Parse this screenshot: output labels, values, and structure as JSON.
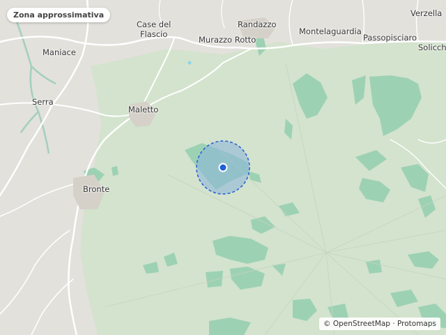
{
  "map": {
    "area_label": "Zona approssimativa",
    "attribution": "© OpenStreetMap · Protomaps",
    "places": {
      "casedelflascio": "Case del\nFlascio",
      "randazzo": "Randazzo",
      "murazzorotto": "Murazzo Rotto",
      "montelaguardia": "Montelaguardia",
      "passopisciaro": "Passopisciaro",
      "verzella": "Verzella",
      "solicchiata": "Solicchi",
      "maniace": "Maniace",
      "serra": "Serra",
      "maletto": "Maletto",
      "bronte": "Bronte"
    },
    "colors": {
      "background": "#e3e1dc",
      "park": "#d3e3cd",
      "woods": "#9dd1b4",
      "road": "#ffffff",
      "river": "#a3cfbf",
      "marker": "#1d5fd6",
      "radius_fill": "#8bb5dc",
      "radius_stroke": "#2a63d4"
    }
  }
}
